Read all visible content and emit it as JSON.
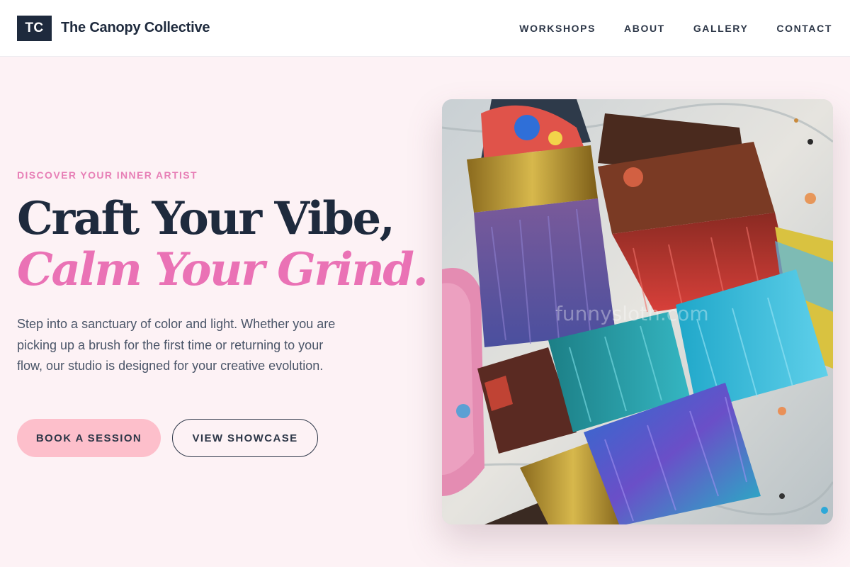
{
  "header": {
    "logo_text": "TC",
    "brand_name": "The Canopy Collective",
    "nav": [
      "WORKSHOPS",
      "ABOUT",
      "GALLERY",
      "CONTACT"
    ]
  },
  "hero": {
    "eyebrow": "DISCOVER YOUR INNER ARTIST",
    "headline_line1": "Craft Your Vibe,",
    "headline_line2": "Calm Your Grind.",
    "body": "Step into a sanctuary of color and light. Whether you are picking up a brush for the first time or returning to your flow, our studio is designed for your creative evolution.",
    "primary_button": "BOOK A SESSION",
    "secondary_button": "VIEW SHOWCASE",
    "image": {
      "subject": "paint-brushes-photo",
      "watermark": "funnysloth.com"
    }
  },
  "colors": {
    "page_bg": "#fdf2f5",
    "navy": "#1e2a3d",
    "pink_accent": "#ea72b5",
    "button_pink": "#fdbfcb"
  }
}
